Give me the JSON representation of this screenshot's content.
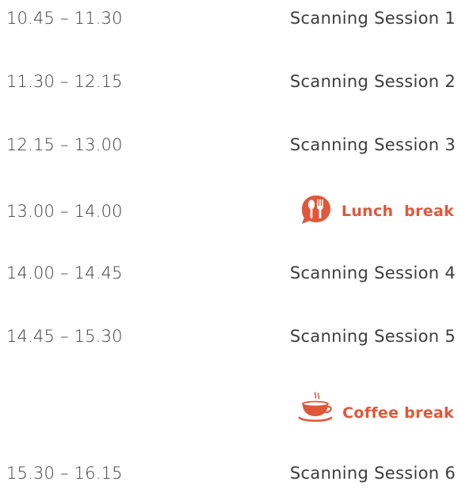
{
  "accent_color": "#e0573a",
  "text_color": "#3d3d3d",
  "schedule": [
    {
      "time": "10.45 – 11.30",
      "session": "Scanning Session 1"
    },
    {
      "time": "11.30 – 12.15",
      "session": "Scanning Session 2"
    },
    {
      "time": "12.15 – 13.00",
      "session": "Scanning Session 3"
    },
    {
      "time": "13.00 – 14.00",
      "break_label": "Lunch  break",
      "break_icon": "fork-spoon-icon"
    },
    {
      "time": "14.00 – 14.45",
      "session": "Scanning Session 4"
    },
    {
      "time": "14.45 – 15.30",
      "session": "Scanning Session 5"
    },
    {
      "time": "",
      "break_label": "Coffee break",
      "break_icon": "coffee-cup-icon"
    },
    {
      "time": "15.30 – 16.15",
      "session": "Scanning Session 6"
    }
  ]
}
